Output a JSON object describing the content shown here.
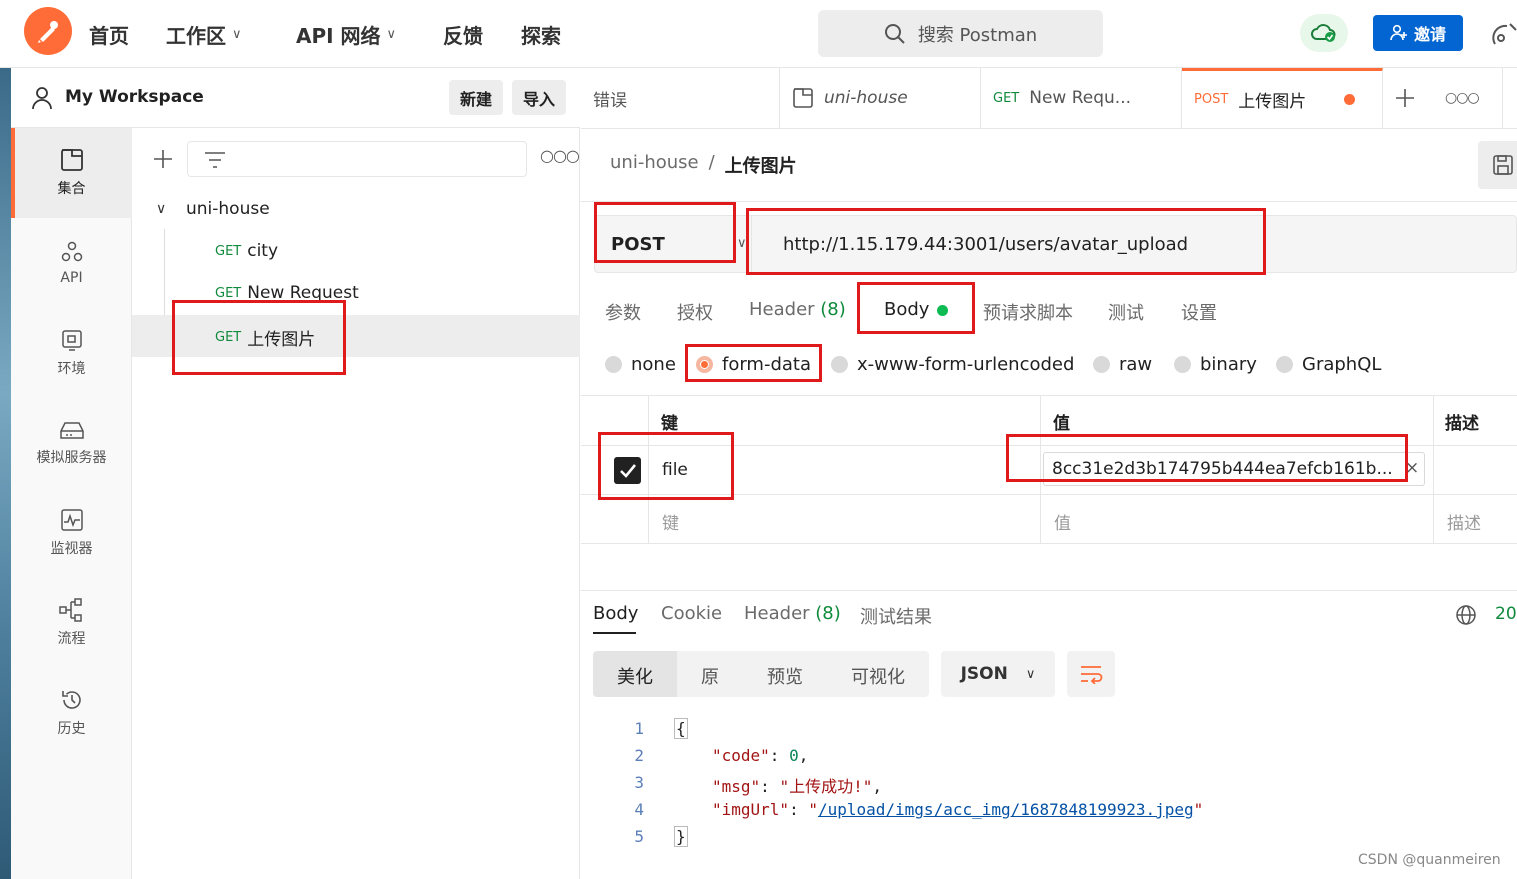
{
  "topbar": {
    "nav": [
      {
        "label": "首页",
        "has_chevron": false
      },
      {
        "label": "工作区",
        "has_chevron": true
      },
      {
        "label": "API 网络",
        "has_chevron": true
      },
      {
        "label": "反馈",
        "has_chevron": false
      },
      {
        "label": "探索",
        "has_chevron": false
      }
    ],
    "search_placeholder": "搜索 Postman",
    "invite_label": "邀请"
  },
  "sidebar": {
    "workspace_name": "My Workspace",
    "new_label": "新建",
    "import_label": "导入",
    "icon_items": [
      {
        "label": "集合",
        "icon": "collections-icon",
        "active": true
      },
      {
        "label": "API",
        "icon": "api-icon",
        "active": false
      },
      {
        "label": "环境",
        "icon": "environment-icon",
        "active": false
      },
      {
        "label": "模拟服务器",
        "icon": "mock-server-icon",
        "active": false
      },
      {
        "label": "监视器",
        "icon": "monitor-icon",
        "active": false
      },
      {
        "label": "流程",
        "icon": "flows-icon",
        "active": false
      },
      {
        "label": "历史",
        "icon": "history-icon",
        "active": false
      }
    ],
    "collection": {
      "name": "uni-house",
      "requests": [
        {
          "method": "GET",
          "name": "city"
        },
        {
          "method": "GET",
          "name": "New Request"
        },
        {
          "method": "GET",
          "name": "上传图片"
        }
      ]
    }
  },
  "tabs": [
    {
      "label": "错误",
      "method": ""
    },
    {
      "label": "uni-house",
      "method": ""
    },
    {
      "label": "New Requ...",
      "method": "GET"
    },
    {
      "label": "上传图片",
      "method": "POST"
    }
  ],
  "request": {
    "breadcrumb_parent": "uni-house",
    "breadcrumb_sep": "/",
    "breadcrumb_current": "上传图片",
    "method": "POST",
    "url": "http://1.15.179.44:3001/users/avatar_upload",
    "subtabs": {
      "params": "参数",
      "auth": "授权",
      "header": "Header",
      "header_count": "(8)",
      "body": "Body",
      "prerequest": "预请求脚本",
      "tests": "测试",
      "settings": "设置"
    },
    "body_types": [
      "none",
      "form-data",
      "x-www-form-urlencoded",
      "raw",
      "binary",
      "GraphQL"
    ],
    "table": {
      "col_key": "键",
      "col_value": "值",
      "col_desc": "描述",
      "row": {
        "key": "file",
        "value": "8cc31e2d3b174795b444ea7efcb161b..."
      },
      "placeholder_key": "键",
      "placeholder_value": "值",
      "placeholder_desc": "描述"
    }
  },
  "response": {
    "tabs": {
      "body": "Body",
      "cookie": "Cookie",
      "header": "Header",
      "header_count": "(8)",
      "test_results": "测试结果"
    },
    "status_partial": "20",
    "view_modes": [
      "美化",
      "原",
      "预览",
      "可视化"
    ],
    "format": "JSON",
    "code_lines": [
      {
        "n": "1"
      },
      {
        "n": "2",
        "key": "\"code\"",
        "val": "0"
      },
      {
        "n": "3",
        "key": "\"msg\"",
        "val": "\"上传成功!\""
      },
      {
        "n": "4",
        "key": "\"imgUrl\"",
        "val": "/upload/imgs/acc_img/1687848199923.jpeg"
      },
      {
        "n": "5"
      }
    ]
  },
  "watermark": "CSDN @quanmeiren",
  "colors": {
    "accent": "#ff6c37",
    "primary_blue": "#0265d2",
    "get_green": "#0f8a3c",
    "annotation_red": "#e0191b"
  }
}
